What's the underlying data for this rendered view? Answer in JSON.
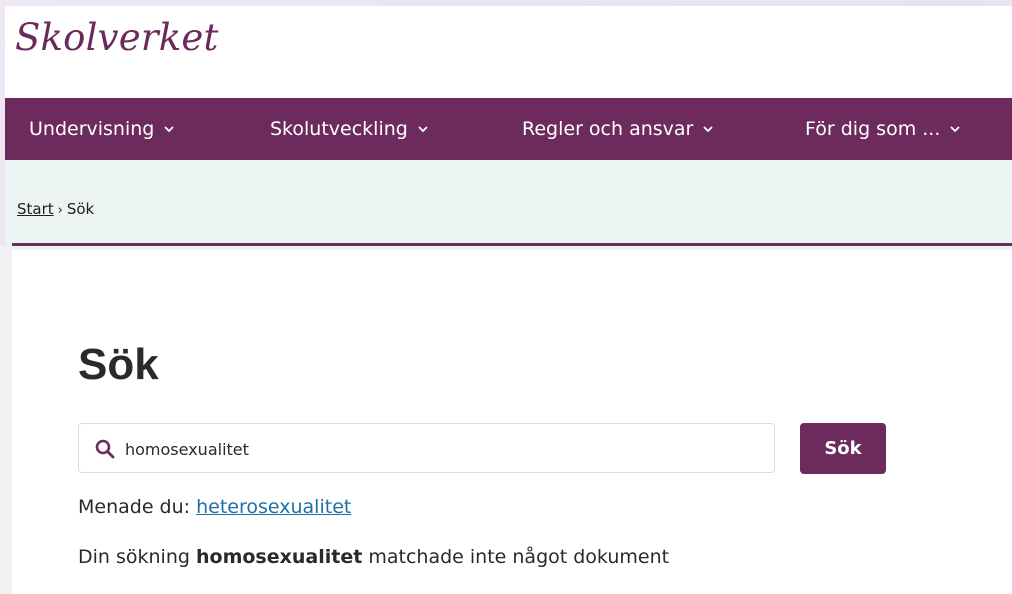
{
  "brand": {
    "logo_text": "Skolverket"
  },
  "nav": {
    "items": [
      {
        "label": "Undervisning"
      },
      {
        "label": "Skolutveckling"
      },
      {
        "label": "Regler och ansvar"
      },
      {
        "label": "För dig som ..."
      }
    ]
  },
  "breadcrumb": {
    "home": "Start",
    "separator": "›",
    "current": "Sök"
  },
  "page": {
    "title": "Sök"
  },
  "search": {
    "value": "homosexualitet",
    "button_label": "Sök"
  },
  "suggestion": {
    "prefix": "Menade du:",
    "link": "heterosexualitet"
  },
  "result": {
    "before": "Din sökning",
    "term": "homosexualitet",
    "after": "matchade inte något dokument"
  },
  "colors": {
    "brand": "#6d2a5d",
    "band": "#ebf3f3",
    "link": "#1f6fa6"
  }
}
